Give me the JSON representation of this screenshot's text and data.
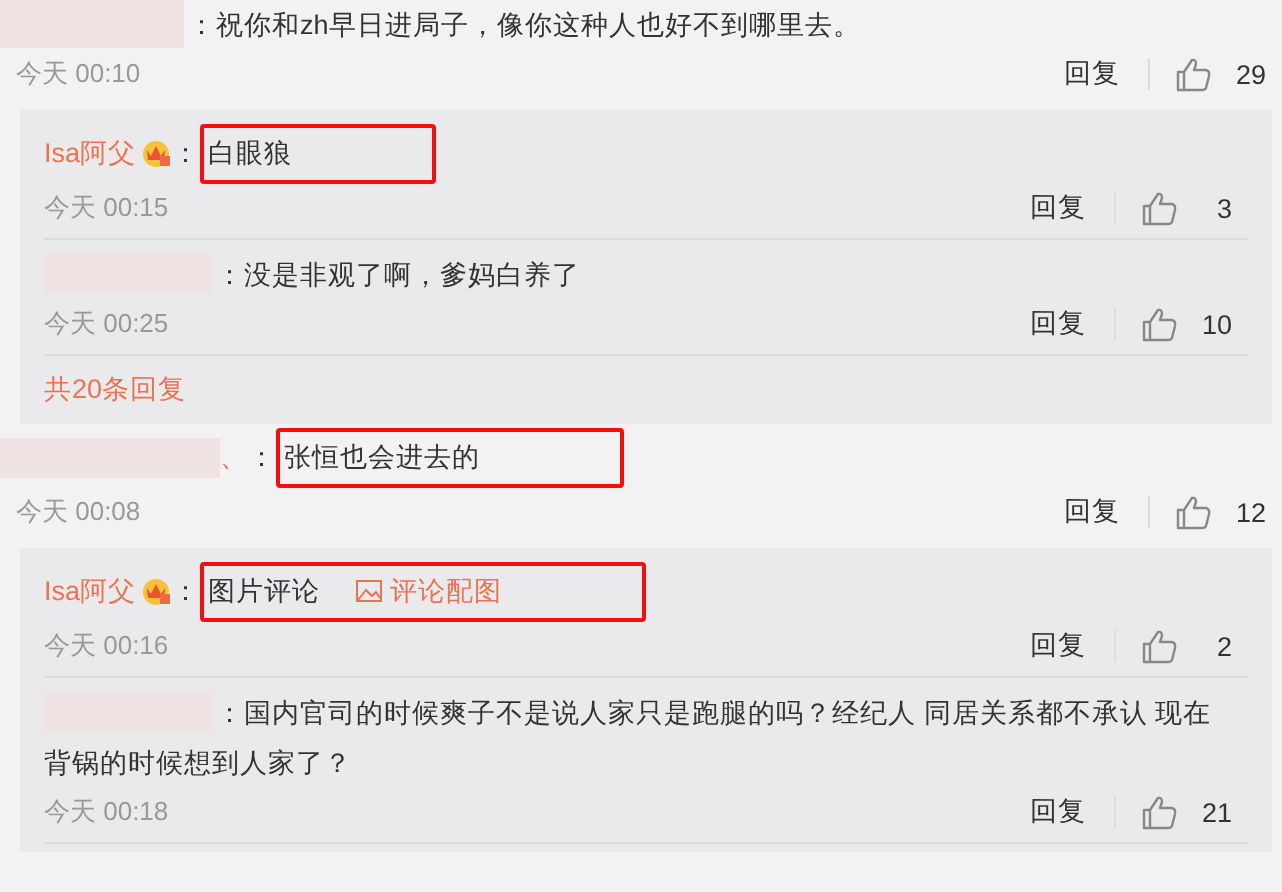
{
  "comments": [
    {
      "author": {
        "redacted": true
      },
      "colon": "：",
      "text": "祝你和zh早日进局子，像你这种人也好不到哪里去。",
      "highlighted": false,
      "time": "今天 00:10",
      "reply_label": "回复",
      "likes": "29",
      "replies": [
        {
          "author": {
            "name": "Isa阿父",
            "badge": true
          },
          "colon": "：",
          "text": "白眼狼",
          "highlighted": true,
          "time": "今天 00:15",
          "reply_label": "回复",
          "likes": "3"
        },
        {
          "author": {
            "redacted": true
          },
          "colon": "：",
          "text": "没是非观了啊，爹妈白养了",
          "highlighted": false,
          "time": "今天 00:25",
          "reply_label": "回复",
          "likes": "10"
        }
      ],
      "more_replies": "共20条回复"
    },
    {
      "author": {
        "redacted": true,
        "name": "、"
      },
      "colon": "：",
      "text": "张恒也会进去的",
      "highlighted": true,
      "time": "今天 00:08",
      "reply_label": "回复",
      "likes": "12",
      "replies": [
        {
          "author": {
            "name": "Isa阿父",
            "badge": true
          },
          "colon": "：",
          "text": "图片评论",
          "image_link": "评论配图",
          "highlighted": true,
          "time": "今天 00:16",
          "reply_label": "回复",
          "likes": "2"
        },
        {
          "author": {
            "redacted": true
          },
          "colon": "：",
          "text": "国内官司的时候爽子不是说人家只是跑腿的吗？经纪人 同居关系都不承认 现在背锅的时候想到人家了？",
          "highlighted": false,
          "time": "今天 00:18",
          "reply_label": "回复",
          "likes": "21"
        }
      ]
    }
  ]
}
